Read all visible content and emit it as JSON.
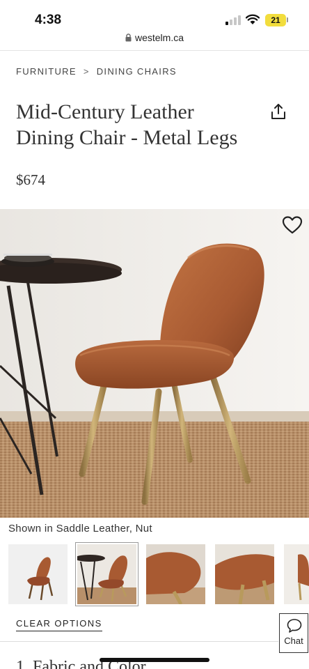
{
  "status": {
    "time": "4:38",
    "battery": "21"
  },
  "browser": {
    "url": "westelm.ca"
  },
  "breadcrumb": {
    "items": [
      "FURNITURE",
      "DINING CHAIRS"
    ],
    "separator": ">"
  },
  "product": {
    "title_line1": "Mid-Century Leather",
    "title_line2": "Dining Chair - Metal Legs",
    "price": "$674",
    "shown_in": "Shown in Saddle Leather, Nut"
  },
  "thumbnails": {
    "count": 6,
    "selected_index": 1
  },
  "actions": {
    "clear_options": "CLEAR OPTIONS",
    "chat": "Chat"
  },
  "next_section": {
    "title": "1. Fabric and Color"
  },
  "colors": {
    "leather": "#a85a32",
    "brass": "#b89a5c",
    "rug": "#b99068"
  },
  "icons": [
    "lock-icon",
    "share-icon",
    "heart-icon",
    "chat-icon",
    "signal-icon",
    "wifi-icon",
    "battery-icon"
  ]
}
